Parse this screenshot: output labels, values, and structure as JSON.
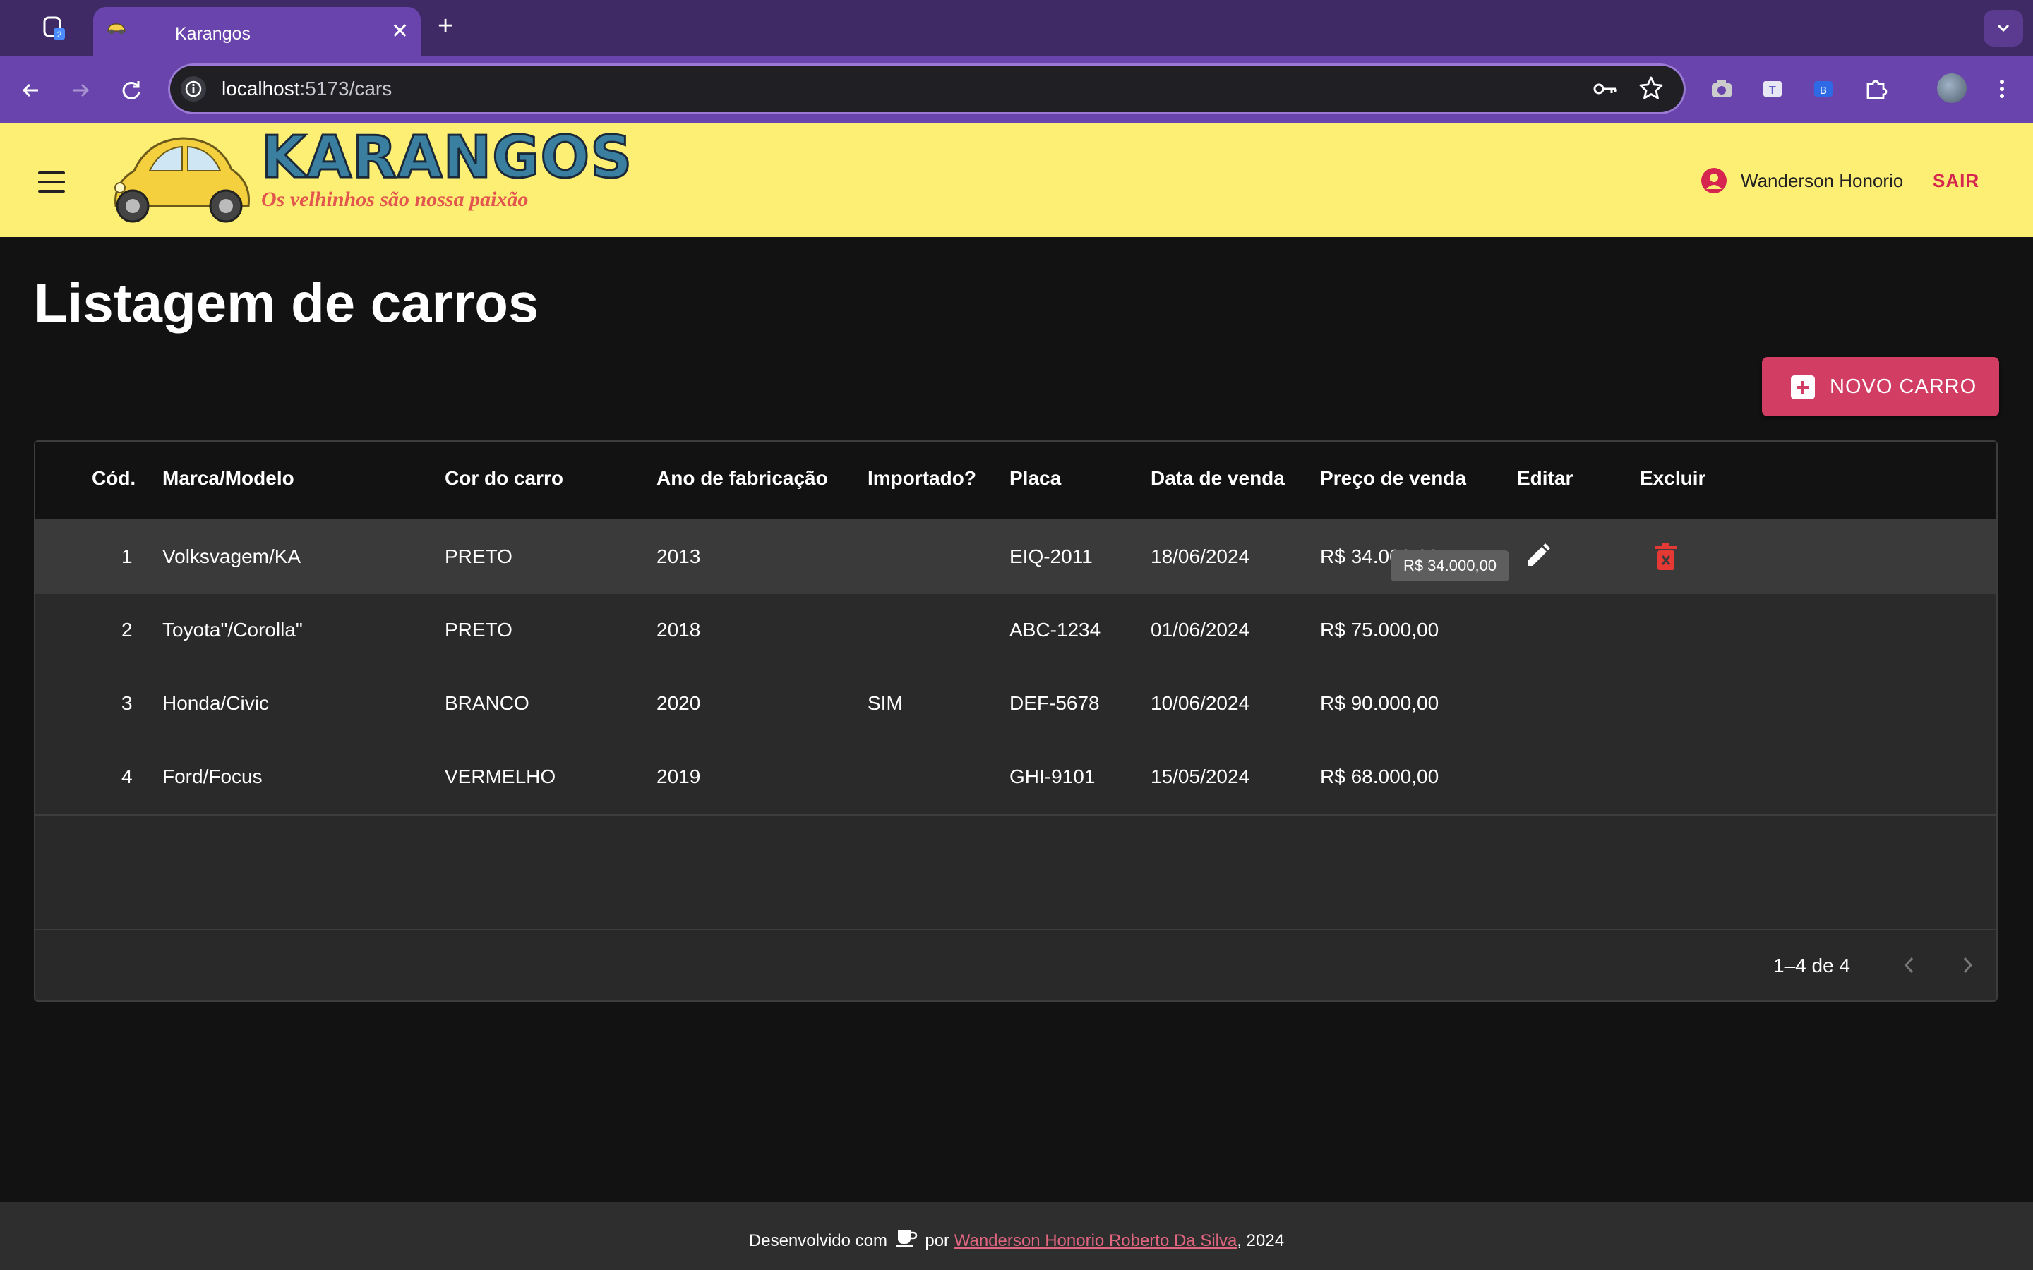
{
  "browser": {
    "tab_title": "Karangos",
    "tab_close": "✕",
    "new_tab": "+",
    "url_host": "localhost",
    "url_path": ":5173/cars"
  },
  "app": {
    "logo_text": "KARANGOS",
    "slogan": "Os velhinhos são nossa paixão",
    "user_name": "Wanderson Honorio",
    "logout_label": "SAIR"
  },
  "page": {
    "title": "Listagem de carros",
    "new_button_label": "NOVO CARRO"
  },
  "table": {
    "columns": [
      "Cód.",
      "Marca/Modelo",
      "Cor do carro",
      "Ano de fabricação",
      "Importado?",
      "Placa",
      "Data de venda",
      "Preço de venda",
      "Editar",
      "Excluir"
    ],
    "rows": [
      {
        "id": "1",
        "model": "Volksvagem/KA",
        "color": "PRETO",
        "year": "2013",
        "imported": "",
        "plate": "EIQ-2011",
        "sale_date": "18/06/2024",
        "price": "R$ 34.000,00"
      },
      {
        "id": "2",
        "model": "Toyota\"/Corolla\"",
        "color": "PRETO",
        "year": "2018",
        "imported": "",
        "plate": "ABC-1234",
        "sale_date": "01/06/2024",
        "price": "R$ 75.000,00"
      },
      {
        "id": "3",
        "model": "Honda/Civic",
        "color": "BRANCO",
        "year": "2020",
        "imported": "SIM",
        "plate": "DEF-5678",
        "sale_date": "10/06/2024",
        "price": "R$ 90.000,00"
      },
      {
        "id": "4",
        "model": "Ford/Focus",
        "color": "VERMELHO",
        "year": "2019",
        "imported": "",
        "plate": "GHI-9101",
        "sale_date": "15/05/2024",
        "price": "R$ 68.000,00"
      }
    ],
    "tooltip": "R$ 34.000,00",
    "pagination": "1–4 de 4"
  },
  "footer": {
    "prefix": "Desenvolvido com",
    "middle": "por",
    "author": "Wanderson Honorio Roberto Da Silva",
    "suffix": ", 2024"
  },
  "colors": {
    "appbar": "#fdef74",
    "accent": "#d23d64",
    "browser_frame": "#6a44ad"
  }
}
